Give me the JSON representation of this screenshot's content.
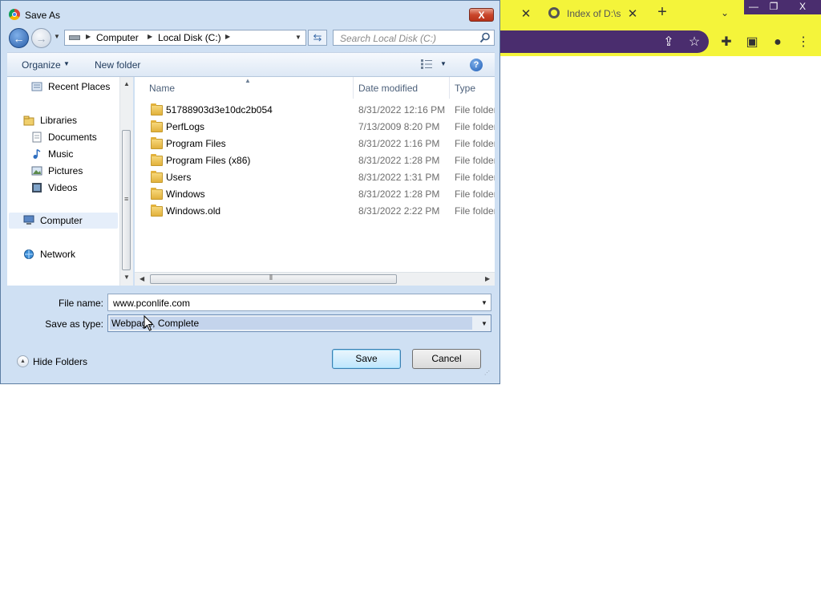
{
  "browser": {
    "tab_title": "Index of D:\\s",
    "new_tab_label": "+",
    "window_minimize": "—",
    "window_restore": "❐",
    "window_close": "X"
  },
  "dialog": {
    "title": "Save As",
    "close_label": "X",
    "address": {
      "crumbs": [
        "Computer",
        "Local Disk (C:)"
      ]
    },
    "search": {
      "placeholder": "Search Local Disk (C:)"
    },
    "toolbar": {
      "organize_label": "Organize",
      "new_folder_label": "New folder"
    },
    "nav": {
      "items": [
        {
          "label": "Recent Places",
          "icon": "recent-places-icon"
        },
        {
          "label": "Libraries",
          "icon": "libraries-icon"
        },
        {
          "label": "Documents",
          "icon": "documents-icon"
        },
        {
          "label": "Music",
          "icon": "music-icon"
        },
        {
          "label": "Pictures",
          "icon": "pictures-icon"
        },
        {
          "label": "Videos",
          "icon": "videos-icon"
        },
        {
          "label": "Computer",
          "icon": "computer-icon"
        },
        {
          "label": "Network",
          "icon": "network-icon"
        }
      ]
    },
    "columns": {
      "name": "Name",
      "date_modified": "Date modified",
      "type": "Type"
    },
    "files": [
      {
        "name": "51788903d3e10dc2b054",
        "date": "8/31/2022 12:16 PM",
        "type": "File folder"
      },
      {
        "name": "PerfLogs",
        "date": "7/13/2009 8:20 PM",
        "type": "File folder"
      },
      {
        "name": "Program Files",
        "date": "8/31/2022 1:16 PM",
        "type": "File folder"
      },
      {
        "name": "Program Files (x86)",
        "date": "8/31/2022 1:28 PM",
        "type": "File folder"
      },
      {
        "name": "Users",
        "date": "8/31/2022 1:31 PM",
        "type": "File folder"
      },
      {
        "name": "Windows",
        "date": "8/31/2022 1:28 PM",
        "type": "File folder"
      },
      {
        "name": "Windows.old",
        "date": "8/31/2022 2:22 PM",
        "type": "File folder"
      }
    ],
    "form": {
      "file_name_label": "File name:",
      "file_name_value": "www.pconlife.com",
      "save_type_label": "Save as type:",
      "save_type_value": "Webpage, Complete"
    },
    "hide_folders_label": "Hide Folders",
    "save_label": "Save",
    "cancel_label": "Cancel"
  },
  "colors": {
    "browser_frame": "#f4f43a",
    "browser_accent": "#4a2d6e",
    "dialog_frame": "#cfe0f3"
  }
}
